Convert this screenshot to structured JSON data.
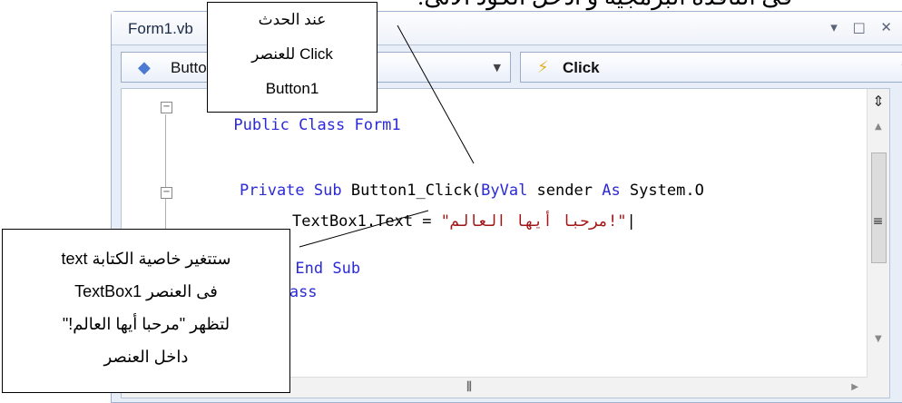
{
  "page": {
    "top_text": "فى النافذة البرمجية و ادخل الكود الآتى:"
  },
  "window": {
    "title": "Form1.vb",
    "controls": "▾ □ ✕"
  },
  "toolbar": {
    "left_combo": {
      "label": "Button1"
    },
    "right_combo": {
      "label": "Click"
    }
  },
  "code": {
    "line1": "Public Class Form1",
    "line2_kw": "Private Sub",
    "line2_rest": " Button1_Click(",
    "line2_kw2": "ByVal",
    "line2_rest2": " sender ",
    "line2_kw3": "As",
    "line2_rest3": " System.O",
    "line3_a": "TextBox1.Text = ",
    "line3_str": "\"مرحبا أيها العالم!\"",
    "line4": "End Sub",
    "line5": "End Class"
  },
  "callouts": {
    "event_lines": [
      "عند الحدث",
      "Click للعنصر",
      "Button1"
    ],
    "text_lines": [
      "ستتغير خاصية الكتابة text",
      "فى العنصر TextBox1",
      "لتظهر \"مرحبا أيها العالم!\"",
      "داخل العنصر"
    ]
  },
  "icons": {
    "left_combo_icon": "component-icon",
    "right_combo_icon": "lightning-icon",
    "split": "split-icon",
    "scroll_grip": "grip-icon"
  }
}
